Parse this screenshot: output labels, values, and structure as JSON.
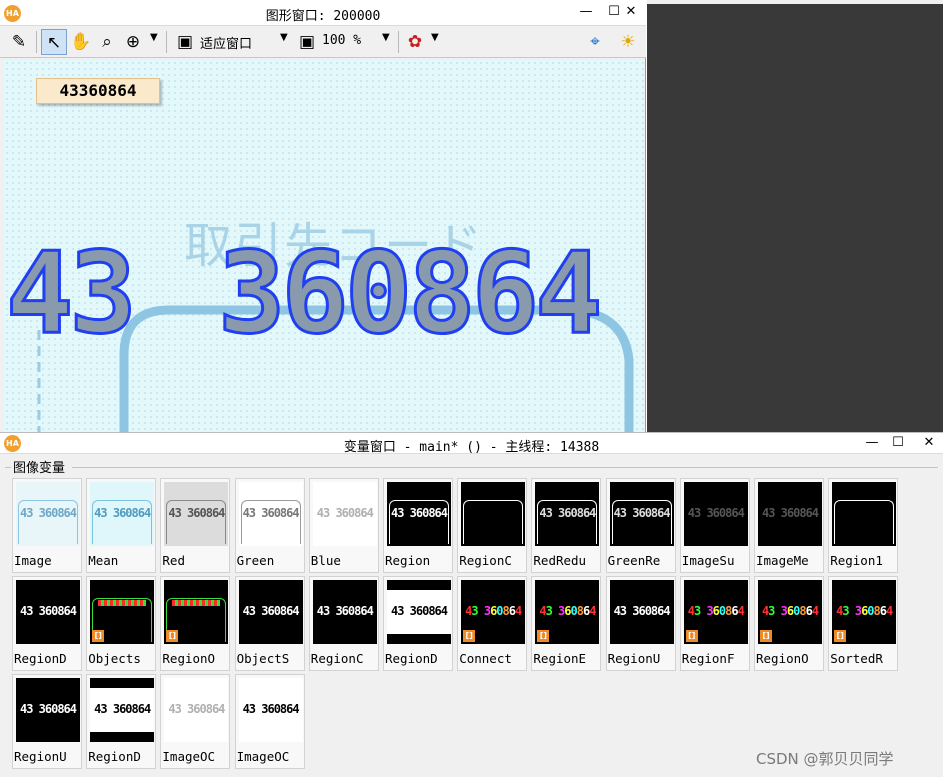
{
  "graphics_window": {
    "title": "图形窗口: 200000",
    "logo_text": "HA",
    "window_controls": {
      "minimize": "—",
      "maximize": "☐",
      "close": "✕"
    },
    "toolbar": {
      "fit_label": "适应窗口",
      "zoom_value": "100 %",
      "icons": [
        "edit-icon",
        "pointer-icon",
        "hand-pan-icon",
        "magnifier-icon",
        "zoom-in-icon",
        "fit-window-icon",
        "zoom-percent-icon",
        "color-pick-icon",
        "crosshair-icon",
        "lightbulb-icon"
      ]
    },
    "canvas": {
      "value_box": "43360864",
      "faint_japanese_text": "取引先コード",
      "digits_left": "43",
      "digits_right": "360864",
      "outline_color": "#1f3ff0",
      "fill_color": "#8a9aad",
      "background_color": "#e3f8fb"
    }
  },
  "variable_window": {
    "title": "变量窗口 - main* () - 主线程: 14388",
    "logo_text": "HA",
    "window_controls": {
      "minimize": "—",
      "maximize": "☐",
      "close": "✕"
    },
    "group_label": "图像变量",
    "rows": [
      [
        {
          "label": "Image",
          "thumb": "light-text",
          "text": "43 360864"
        },
        {
          "label": "Mean",
          "thumb": "cyan-text",
          "text": "43 360864"
        },
        {
          "label": "Red",
          "thumb": "gray-text",
          "text": "43 360864"
        },
        {
          "label": "Green",
          "thumb": "white-text",
          "text": "43 360864"
        },
        {
          "label": "Blue",
          "thumb": "white-faint",
          "text": "43 360864"
        },
        {
          "label": "Region",
          "thumb": "black-white-frame",
          "text": "43 360864"
        },
        {
          "label": "RegionC",
          "thumb": "black-outline-frame",
          "text": ""
        },
        {
          "label": "RedRedu",
          "thumb": "black-outline-frame",
          "text": "43 360864"
        },
        {
          "label": "GreenRe",
          "thumb": "black-outline-frame",
          "text": "43 360864"
        },
        {
          "label": "ImageSu",
          "thumb": "black-dim",
          "text": "43 360864"
        },
        {
          "label": "ImageMe",
          "thumb": "black-dim",
          "text": "43 360864"
        },
        {
          "label": "Region1",
          "thumb": "black-white-frame",
          "text": ""
        }
      ],
      [
        {
          "label": "RegionD",
          "thumb": "black-white-text",
          "text": "43 360864"
        },
        {
          "label": "Objects",
          "thumb": "black-green-red",
          "text": "",
          "badge": true
        },
        {
          "label": "RegionO",
          "thumb": "black-green-red",
          "text": "",
          "badge": true
        },
        {
          "label": "ObjectS",
          "thumb": "black-white-text",
          "text": "43 360864"
        },
        {
          "label": "RegionC",
          "thumb": "black-white-text",
          "text": "43 360864"
        },
        {
          "label": "RegionD",
          "thumb": "white-band",
          "text": "43 360864"
        },
        {
          "label": "Connect",
          "thumb": "black-color",
          "text": "43 360864",
          "badge": true
        },
        {
          "label": "RegionE",
          "thumb": "black-color",
          "text": "43 360864",
          "badge": true
        },
        {
          "label": "RegionU",
          "thumb": "black-white-text",
          "text": "43 360864"
        },
        {
          "label": "RegionF",
          "thumb": "black-color",
          "text": "43 360864",
          "badge": true
        },
        {
          "label": "RegionO",
          "thumb": "black-color",
          "text": "43 360864",
          "badge": true
        },
        {
          "label": "SortedR",
          "thumb": "black-color",
          "text": "43 360864",
          "badge": true
        }
      ],
      [
        {
          "label": "RegionU",
          "thumb": "black-white-text",
          "text": "43 360864"
        },
        {
          "label": "RegionD",
          "thumb": "white-band",
          "text": "43 360864"
        },
        {
          "label": "ImageOC",
          "thumb": "white-faint",
          "text": "43 360864"
        },
        {
          "label": "ImageOC",
          "thumb": "white-bold",
          "text": "43 360864"
        }
      ]
    ]
  },
  "watermark": "CSDN @郭贝贝同学"
}
